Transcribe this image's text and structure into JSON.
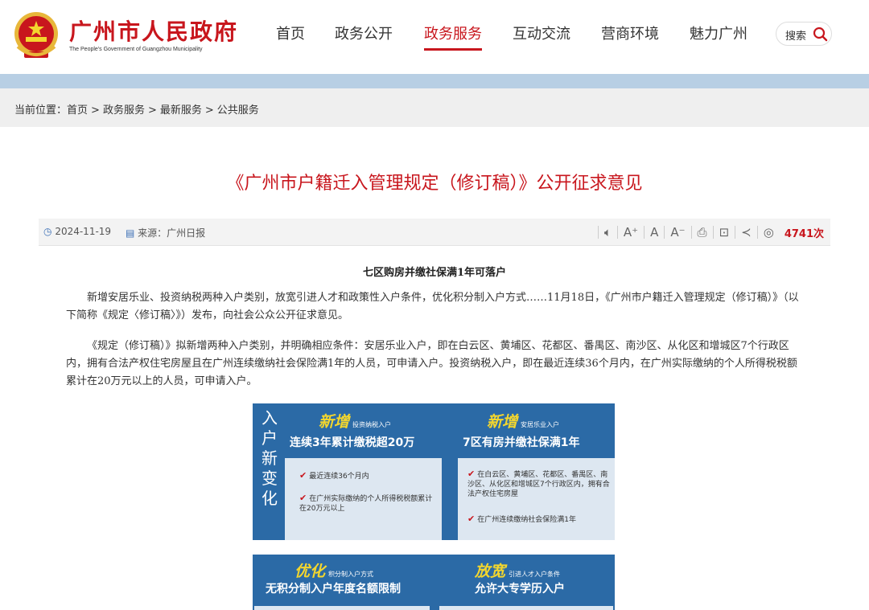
{
  "header": {
    "site_title": "广州市人民政府",
    "site_subtitle": "The People's Government of Guangzhou Municipality",
    "nav": [
      {
        "label": "首页"
      },
      {
        "label": "政务公开"
      },
      {
        "label": "政务服务"
      },
      {
        "label": "互动交流"
      },
      {
        "label": "营商环境"
      },
      {
        "label": "魅力广州"
      }
    ],
    "active_nav": "政务服务",
    "search_label": "搜索"
  },
  "breadcrumb": {
    "prefix": "当前位置：",
    "items": [
      "首页",
      "政务服务",
      "最新服务",
      "公共服务"
    ],
    "separator": ">"
  },
  "article": {
    "title": "《广州市户籍迁入管理规定（修订稿）》公开征求意见",
    "date": "2024-11-19",
    "source": "来源：广州日报",
    "views": "4741次",
    "subtitle": "七区购房并缴社保满1年可落户",
    "paragraphs": [
      "新增安居乐业、投资纳税两种入户类别，放宽引进人才和政策性入户条件，优化积分制入户方式……11月18日，《广州市户籍迁入管理规定（修订稿）》（以下简称《规定〈修订稿〉》）发布，向社会公众公开征求意见。",
      "《规定（修订稿）》拟新增两种入户类别，并明确相应条件：安居乐业入户，即在白云区、黄埔区、花都区、番禺区、南沙区、从化区和增城区7个行政区内，拥有合法产权住宅房屋且在广州连续缴纳社会保险满1年的人员，可申请入户。投资纳税入户，即在最近连续36个月内，在广州实际缴纳的个人所得税税额累计在20万元以上的人员，可申请入户。"
    ]
  },
  "toolbar": {
    "speak_icon": "speaker-icon",
    "font_large": "A⁺",
    "font_mid": "A",
    "font_small": "A⁻"
  },
  "infographic": {
    "side_text": [
      "入",
      "户",
      "新",
      "变",
      "化"
    ],
    "left": {
      "head_big": "新增",
      "head_tag": "投资纳税入户",
      "big_line": "连续3年累计缴税超20万",
      "items": [
        "最近连续36个月内",
        "在广州实际缴纳的个人所得税税额累计在20万元以上"
      ]
    },
    "right": {
      "head_big": "新增",
      "head_tag": "安居乐业入户",
      "big_line": "7区有房并缴社保满1年",
      "items": [
        "在白云区、黄埔区、花都区、番禺区、南沙区、从化区和增城区7个行政区内，拥有合法产权住宅房屋",
        "在广州连续缴纳社会保险满1年"
      ]
    }
  },
  "infographic2": {
    "left": {
      "head_big": "优化",
      "head_tag": "积分制入户方式",
      "big_line": "无积分制入户年度名额限制"
    },
    "right": {
      "head_big": "放宽",
      "head_tag": "引进人才入户条件",
      "big_line": "允许大专学历入户"
    }
  },
  "colors": {
    "brand_red": "#c8161d",
    "band_blue": "#b8cfe4",
    "info_blue": "#2b6aa6",
    "info_yellow": "#f3d62e"
  }
}
